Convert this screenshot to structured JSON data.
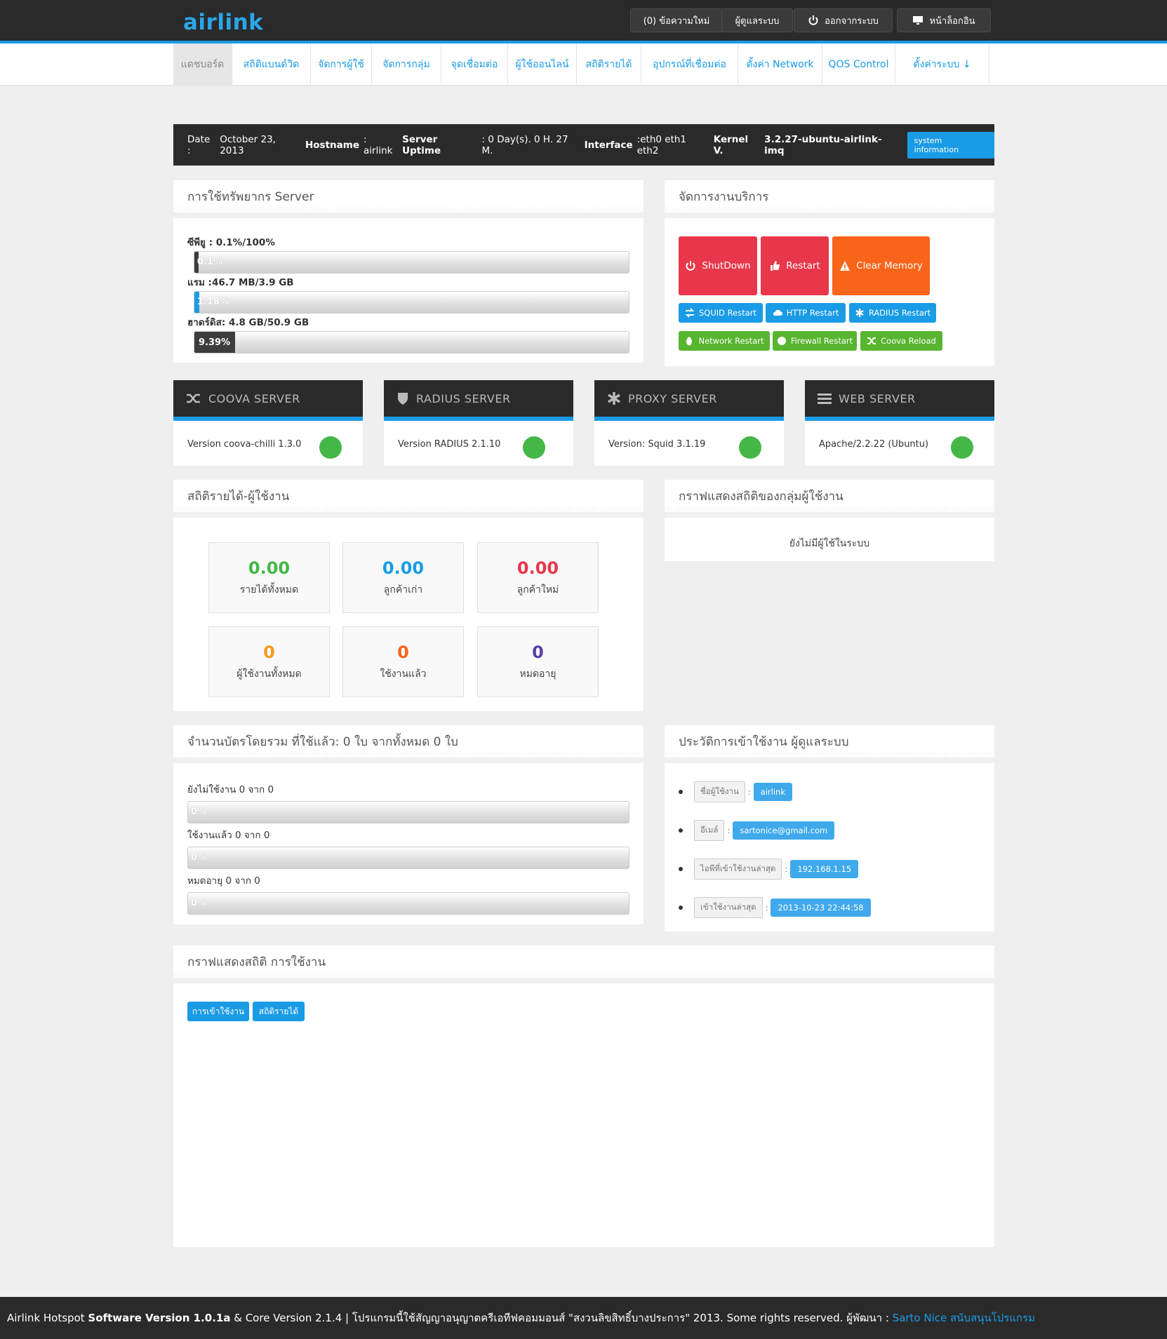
{
  "header": {
    "logo": "airlink",
    "messages": "(0) ข้อความใหม่",
    "admin": "ผู้ดูแลระบบ",
    "logout": "ออกจากระบบ",
    "login_page": "หน้าล็อกอิน"
  },
  "nav": [
    "แดชบอร์ด",
    "สถิติแบนด์วิด",
    "จัดการผู้ใช้",
    "จัดการกลุ่ม",
    "จุดเชื่อมต่อ",
    "ผู้ใช้ออนไลน์",
    "สถิติรายได้",
    "อุปกรณ์ที่เชื่อมต่อ",
    "ตั้งค่า Network",
    "QOS Control",
    "ตั้งค่าระบบ ↓"
  ],
  "info": {
    "date_label": "Date :",
    "date": "October 23, 2013",
    "hostname_label": "Hostname",
    "hostname": ": airlink",
    "uptime_label": "Server Uptime",
    "uptime": ": 0 Day(s). 0 H. 27 M.",
    "interface_label": "Interface",
    "interface": ":eth0 eth1 eth2",
    "kernel_label": "Kernel V.",
    "kernel": "3.2.27-ubuntu-airlink-imq",
    "sysinfo_button": "system information"
  },
  "resources": {
    "title": "การใช้ทรัพยากร Server",
    "cpu_label": "ซีพียู : 0.1%/100%",
    "cpu_pct_label": "0.1%",
    "cpu_pct": 0.1,
    "ram_label": "แรม :46.7 MB/3.9 GB",
    "ram_pct_label": "1.18%",
    "ram_pct": 1.18,
    "disk_label": "ฮาดร์ดิส: 4.8 GB/50.9 GB",
    "disk_pct_label": "9.39%",
    "disk_pct": 9.39
  },
  "services": {
    "title": "จัดการงานบริการ",
    "shutdown": "ShutDown",
    "restart": "Restart",
    "clear_memory": "Clear Memory",
    "squid": "SQUID Restart",
    "http": "HTTP Restart",
    "radius": "RADIUS Restart",
    "network": "Network Restart",
    "firewall": "Firewall Restart",
    "coova": "Coova Reload"
  },
  "servers": [
    {
      "title": "COOVA SERVER",
      "version": "Version coova-chilli 1.3.0"
    },
    {
      "title": "RADIUS SERVER",
      "version": "Version RADIUS 2.1.10"
    },
    {
      "title": "PROXY SERVER",
      "version": "Version: Squid  3.1.19"
    },
    {
      "title": "WEB SERVER",
      "version": "Apache/2.2.22 (Ubuntu)"
    }
  ],
  "revenue": {
    "title": "สถิติรายได้-ผู้ใช้งาน",
    "stats": [
      {
        "value": "0.00",
        "caption": "รายได้ทั้งหมด",
        "color": "#44b747"
      },
      {
        "value": "0.00",
        "caption": "ลูกค้าเก่า",
        "color": "#1a9be6"
      },
      {
        "value": "0.00",
        "caption": "ลูกค้าใหม่",
        "color": "#e8374a"
      },
      {
        "value": "0",
        "caption": "ผู้ใช้งานทั้งหมด",
        "color": "#f79a1e"
      },
      {
        "value": "0",
        "caption": "ใช้งานแล้ว",
        "color": "#f9641b"
      },
      {
        "value": "0",
        "caption": "หมดอายุ",
        "color": "#5b3fa8"
      }
    ]
  },
  "group_chart": {
    "title": "กราฟแสดงสถิติของกลุ่มผู้ใช้งาน",
    "empty": "ยังไม่มีผู้ใช้ในระบบ"
  },
  "cards": {
    "title": "จำนวนบัตรโดยรวม ที่ใช้แล้ว: 0 ใบ จากทั้งหมด 0 ใบ",
    "rows": [
      {
        "label": "ยังไม่ใช้งาน 0 จาก 0",
        "pct": "0%"
      },
      {
        "label": "ใช้งานแล้ว 0 จาก 0",
        "pct": "0%"
      },
      {
        "label": "หมดอายุ 0 จาก 0",
        "pct": "0%"
      }
    ]
  },
  "history": {
    "title": "ประวัติการเข้าใช้งาน ผู้ดูแลระบบ",
    "rows": [
      {
        "key": "ชื่อผู้ใช้งาน",
        "value": "airlink"
      },
      {
        "key": "อีเมล์",
        "value": "sartonice@gmail.com"
      },
      {
        "key": "ไอพีที่เข้าใช้งานล่าสุด",
        "value": "192.168.1.15"
      },
      {
        "key": "เข้าใช้งานล่าสุด",
        "value": "2013-10-23 22:44:58"
      }
    ]
  },
  "usage_chart": {
    "title": "กราฟแสดงสถิติ การใช้งาน",
    "tab_usage": "การเข้าใช้งาน",
    "tab_revenue": "สถิติรายได้"
  },
  "footer": {
    "text1": "Airlink Hotspot",
    "text2": "Software Version 1.0.1a",
    "text3": "& Core Version 2.1.4 | โปรแกรมนี้ใช้สัญญาอนุญาตครีเอทีฟคอมมอนส์ \"สงวนลิขสิทธิ์บางประการ\" 2013. Some rights reserved. ผู้พัฒนา :",
    "author": "Sarto Nice",
    "support": "สนับสนุนโปรแกรม"
  }
}
